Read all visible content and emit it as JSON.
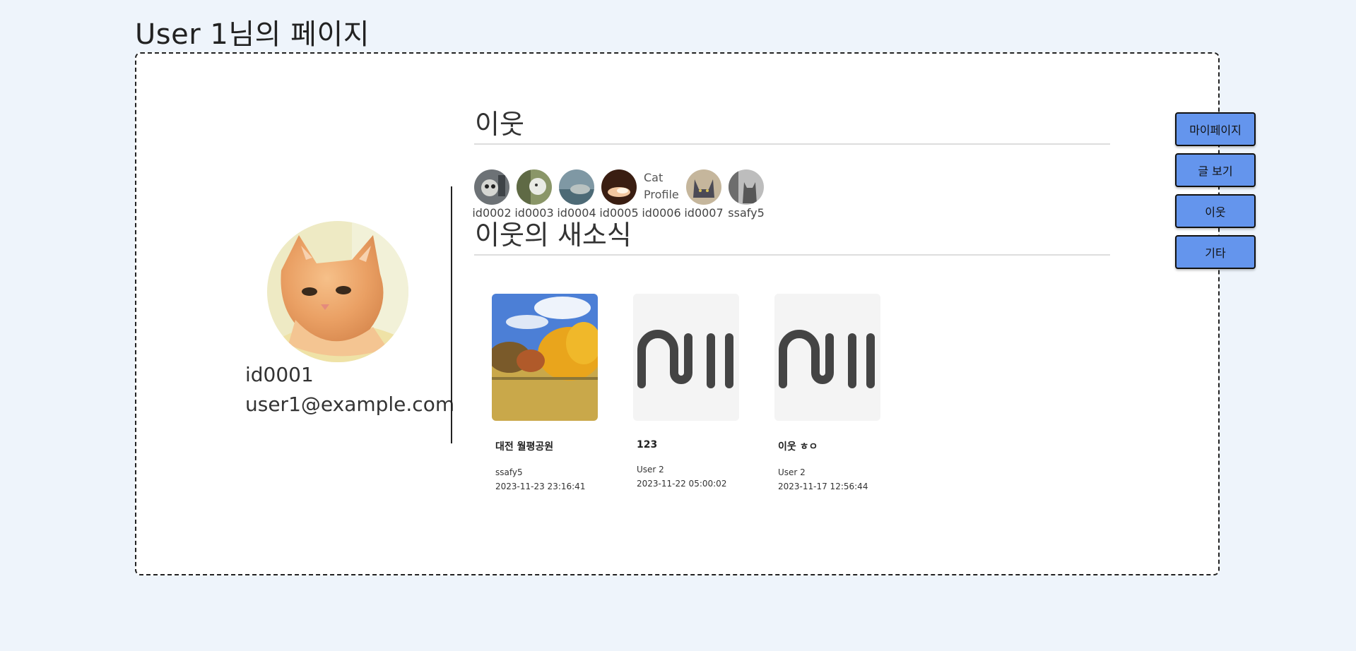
{
  "page": {
    "title": "User 1님의 페이지"
  },
  "profile": {
    "id": "id0001",
    "email": "user1@example.com"
  },
  "neighbors_section": {
    "title": "이웃",
    "items": [
      {
        "label": "id0002",
        "broken": false
      },
      {
        "label": "id0003",
        "broken": false
      },
      {
        "label": "id0004",
        "broken": false
      },
      {
        "label": "id0005",
        "broken": false
      },
      {
        "label": "id0006",
        "broken": true,
        "alt": "Cat Profile"
      },
      {
        "label": "id0007",
        "broken": false
      },
      {
        "label": "ssafy5",
        "broken": false
      }
    ]
  },
  "news_section": {
    "title": "이웃의 새소식",
    "posts": [
      {
        "title": "대전 월평공원",
        "author": "ssafy5",
        "date": "2023-11-23 23:16:41",
        "thumb": "photo"
      },
      {
        "title": "123",
        "author": "User 2",
        "date": "2023-11-22 05:00:02",
        "thumb": "null-logo"
      },
      {
        "title": "이웃 ㅎㅇ",
        "author": "User 2",
        "date": "2023-11-17 12:56:44",
        "thumb": "null-logo"
      }
    ]
  },
  "side_nav": {
    "mypage": "마이페이지",
    "posts": "글 보기",
    "neighbors": "이웃",
    "etc": "기타",
    "accent": "#6495ed"
  }
}
